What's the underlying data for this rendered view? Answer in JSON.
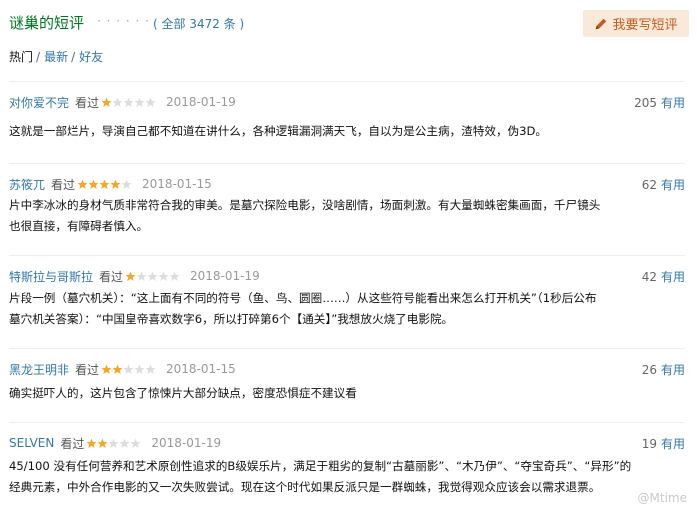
{
  "header": {
    "title": "谜巢的短评",
    "dots": "· · · · · ·",
    "count": "( 全部 3472 条 )",
    "write_label": "我要写短评"
  },
  "sorts": [
    {
      "label": "热门",
      "active": true
    },
    {
      "label": "最新",
      "active": false
    },
    {
      "label": "好友",
      "active": false
    }
  ],
  "sort_separator": "/",
  "watched_label": "看过",
  "useful_label": "有用",
  "comments": [
    {
      "author": "对你爱不完",
      "rating": 1,
      "date": "2018-01-19",
      "votes": "205",
      "lines": [
        "这就是一部烂片，导演自己都不知道在讲什么，各种逻辑漏洞满天飞，自以为是公主病，渣特效，伪3D。"
      ]
    },
    {
      "author": "苏筱兀",
      "rating": 4,
      "date": "2018-01-15",
      "votes": "62",
      "lines": [
        "片中李冰冰的身材气质非常符合我的审美。是墓穴探险电影，没啥剧情，场面刺激。有大量蜘蛛密集画面，千尸镜头",
        "也很直接，有障碍者慎入。"
      ]
    },
    {
      "author": "特斯拉与哥斯拉",
      "rating": 1,
      "date": "2018-01-19",
      "votes": "42",
      "lines": [
        "片段一例（墓穴机关）：“这上面有不同的符号（鱼、鸟、圆圈……）从这些符号能看出来怎么打开机关”（1秒后公布",
        "墓穴机关答案）：“中国皇帝喜欢数字6，所以打碎第6个【通关】”我想放火烧了电影院。"
      ]
    },
    {
      "author": "黑龙王明非",
      "rating": 2,
      "date": "2018-01-15",
      "votes": "26",
      "lines": [
        "确实挺吓人的，这片包含了惊悚片大部分缺点，密度恐惧症不建议看"
      ]
    },
    {
      "author": "SELVEN",
      "rating": 2,
      "date": "2018-01-19",
      "votes": "19",
      "lines": [
        "45/100 没有任何营养和艺术原创性追求的B级娱乐片，满足于粗劣的复制“古墓丽影”、“木乃伊”、“夺宝奇兵”、“异形”的",
        "经典元素，中外合作电影的又一次失败尝试。现在这个时代如果反派只是一群蜘蛛，我觉得观众应该会以需求退票。"
      ]
    }
  ],
  "watermark": "@Mtime",
  "colors": {
    "title_green": "#007722",
    "link_blue": "#3377aa",
    "star_on": "#f5a623",
    "star_off": "#dddddd",
    "button_bg": "#f8e9d9",
    "button_text": "#c45b20"
  },
  "icons": {
    "write": "pencil-icon",
    "star": "star-icon"
  }
}
